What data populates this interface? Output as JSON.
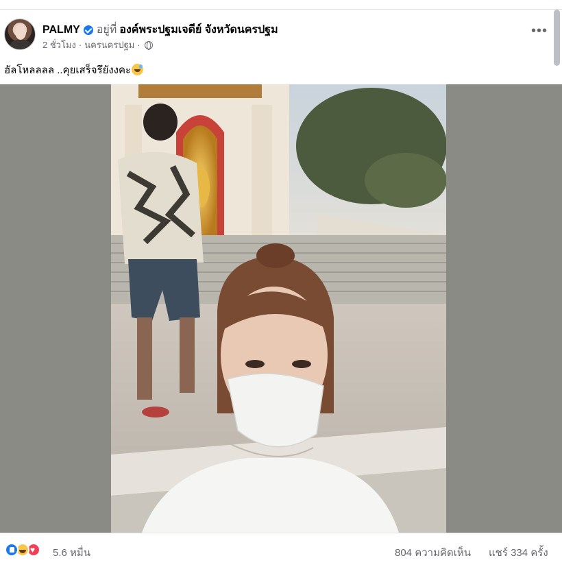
{
  "post": {
    "author": "PALMY",
    "at_word": "อยู่ที่",
    "place": "องค์พระปฐมเจดีย์ จังหวัดนครปฐม",
    "time": "2 ชั่วโมง",
    "separator": "·",
    "location": "นครนครปฐม",
    "privacy_icon": "globe-icon",
    "more_icon": "ellipsis-icon",
    "more_label": "•••",
    "caption": "ฮัลโหลลลล ..คุยเสร็จรึยังงคะ",
    "caption_emoji": "grinning-face-with-sweat"
  },
  "engagement": {
    "reaction_icons": [
      "like-icon",
      "haha-icon",
      "love-icon"
    ],
    "reaction_count": "5.6 หมื่น",
    "comments": "804 ความคิดเห็น",
    "shares": "แชร์ 334 ครั้ง"
  },
  "colors": {
    "accent": "#1877f2",
    "secondary_text": "#65676b",
    "media_backdrop": "#8a8b85"
  }
}
